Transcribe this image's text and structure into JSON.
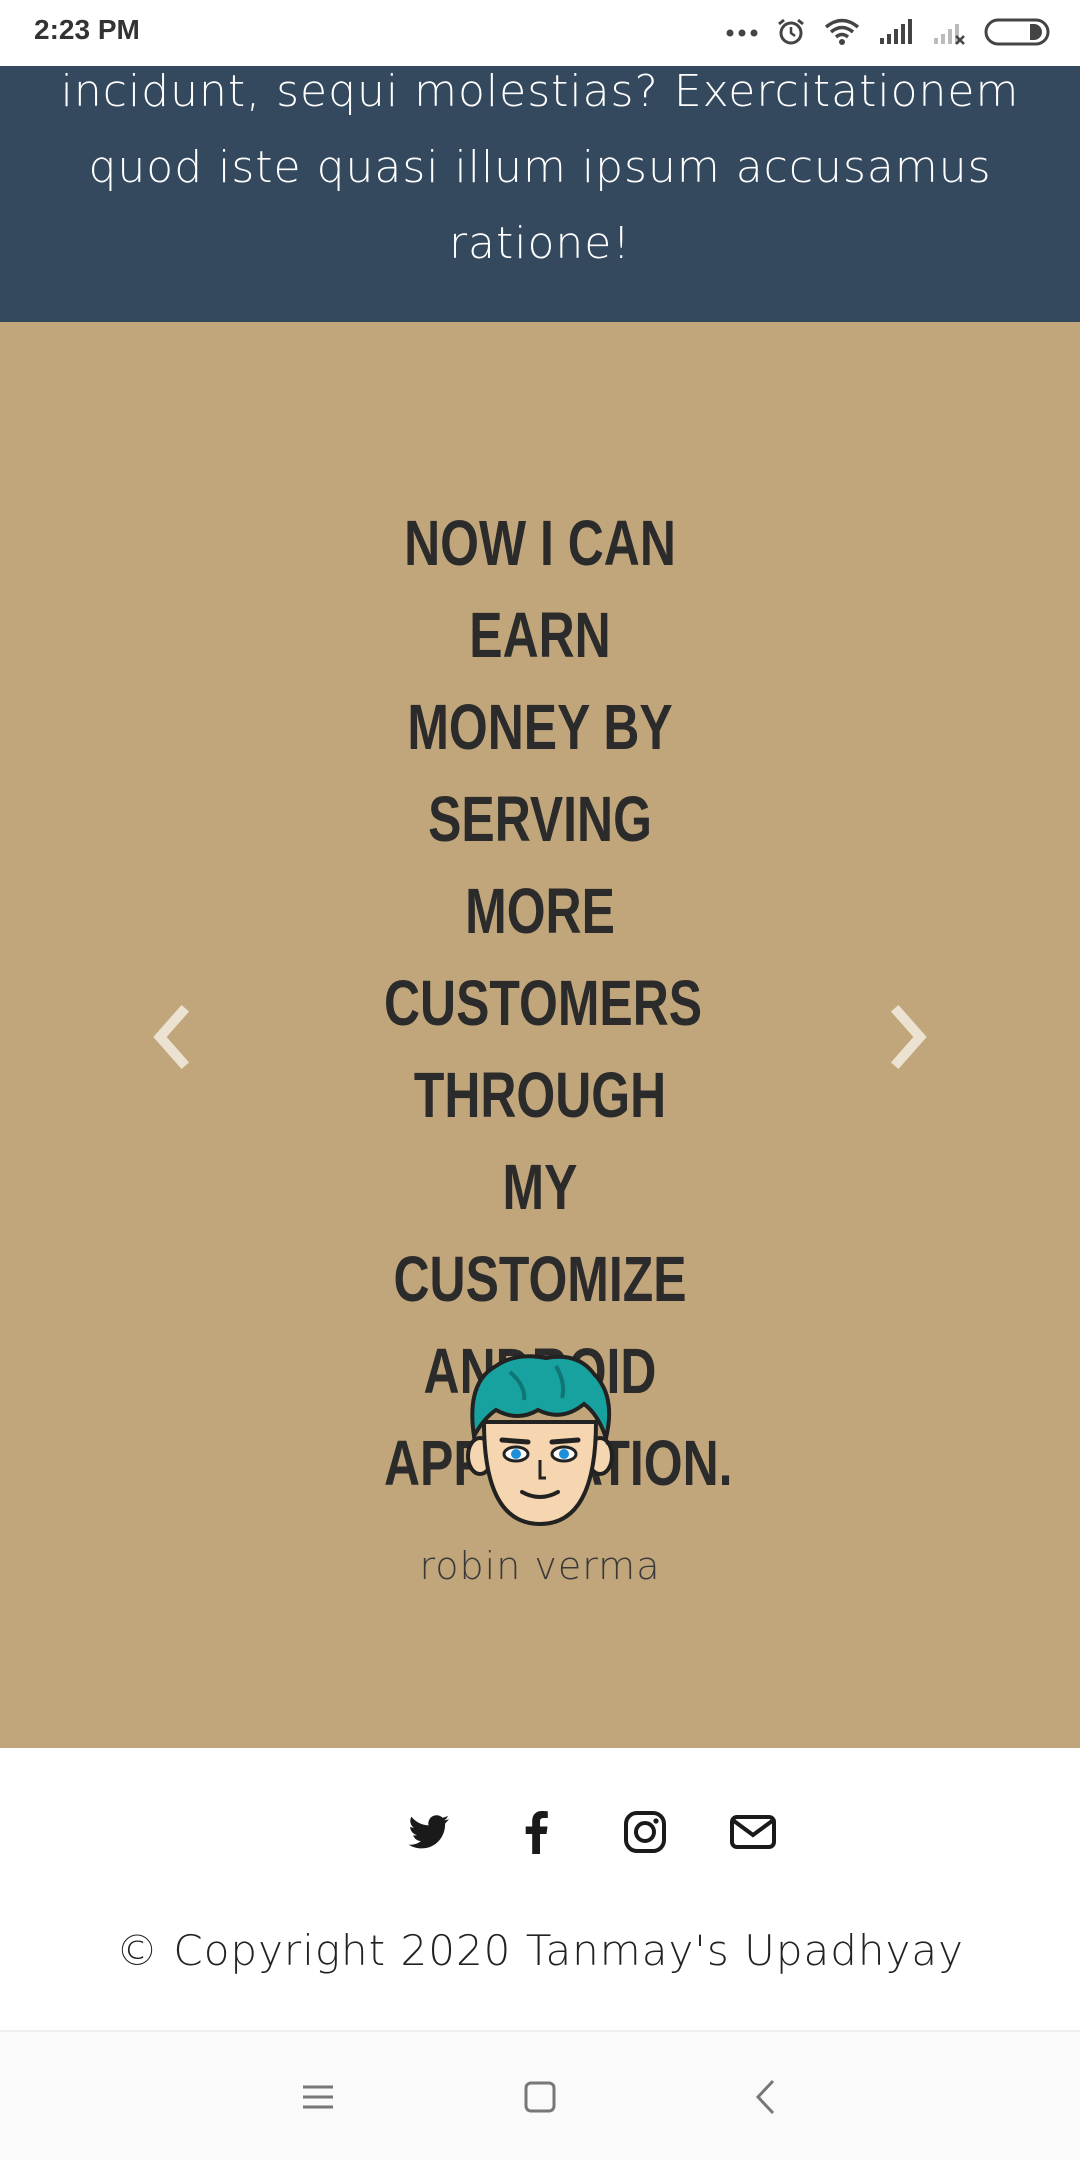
{
  "status_bar": {
    "time": "2:23 PM",
    "icons": [
      "more-dots-icon",
      "alarm-icon",
      "wifi-icon",
      "signal-icon",
      "signal-off-icon",
      "battery-icon"
    ]
  },
  "hero": {
    "text": "incidunt, sequi molestias? Exercitationem quod iste quasi illum ipsum accusamus ratione!",
    "background": "#34495e"
  },
  "testimonial": {
    "background": "#c2a67b",
    "quote": "Now I can earn money by serving more customers through my customize android applciation.",
    "author": "robin verma",
    "prev_icon": "chevron-left-icon",
    "next_icon": "chevron-right-icon",
    "avatar_icon": "avatar-icon"
  },
  "footer": {
    "social": [
      "twitter-icon",
      "facebook-icon",
      "instagram-icon",
      "envelope-icon"
    ],
    "copyright": "© Copyright 2020 Tanmay's Upadhyay"
  },
  "nav_bar": {
    "buttons": [
      "menu-icon",
      "home-icon",
      "back-icon"
    ]
  }
}
